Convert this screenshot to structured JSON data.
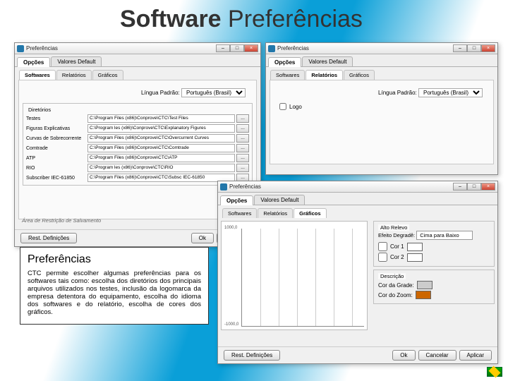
{
  "slide_title": {
    "bold": "Software",
    "rest": " Preferências"
  },
  "window_title": "Preferências",
  "tabs": {
    "opcoes": "Opções",
    "valores_default": "Valores Default"
  },
  "subtabs": {
    "softwares": "Softwares",
    "relatorios": "Relatórios",
    "graficos": "Gráficos"
  },
  "lang": {
    "label": "Língua Padrão:",
    "value": "Português (Brasil)"
  },
  "dirs": {
    "legend": "Diretórios",
    "rows": [
      {
        "label": "Testes",
        "path": "C:\\Program Files (x86)\\Conprove\\CTC\\Test Files"
      },
      {
        "label": "Figuras Explicativas",
        "path": "C:\\Program  les (x86)\\Conprove\\CTC\\Explanatory Figures"
      },
      {
        "label": "Curvas de Sobrecorrente",
        "path": "C:\\Program Files (x86)\\Conprove\\CTC\\Overcurrent Curves"
      },
      {
        "label": "Comtrade",
        "path": "C:\\Program Files (x86)\\Conprove\\CTC\\Comtrade"
      },
      {
        "label": "ATP",
        "path": "C:\\Program Files (x86)\\Conprove\\CTC\\ATP"
      },
      {
        "label": "RIO",
        "path": "C:\\Program  les (x86)\\Conprove\\CTC\\RIO"
      },
      {
        "label": "Subscriber IEC-61850",
        "path": "C:\\Program Files (x86)\\Conprove\\CTC\\Subsc IEC-61850"
      }
    ]
  },
  "restore_note": "Área de Restrição de Salvamento",
  "buttons": {
    "restore": "Rest. Definições",
    "ok": "Ok",
    "cancel": "Cancelar",
    "apply": "Aplicar"
  },
  "reports": {
    "logo_check": "Logo"
  },
  "graphics": {
    "alpha_legend": "Alto Relevo",
    "alpha_mode_label": "Efeito Degradê:",
    "alpha_mode_value": "Cima para Baixo",
    "cor1": "Cor 1",
    "cor2": "Cor 2",
    "swatch1": "#ffffff",
    "swatch2": "#ffffff",
    "desc_legend": "Descrição",
    "grid_label": "Cor da Grade:",
    "zoom_label": "Cor do Zoom:",
    "grid_swatch": "#cccccc",
    "zoom_swatch": "#cc6600",
    "y_top": "1000,0",
    "y_bot": "-1000,0"
  },
  "winctl": {
    "min": "–",
    "max": "□",
    "close": "×",
    "browse": "..."
  },
  "explain": {
    "heading": "Preferências",
    "body": "CTC permite escolher algumas preferências para os softwares tais como: escolha dos diretórios dos principais arquivos utilizados nos testes, inclusão da logomarca da empresa detentora do equipamento, escolha do idioma dos softwares e do relatório, escolha de cores dos gráficos."
  }
}
